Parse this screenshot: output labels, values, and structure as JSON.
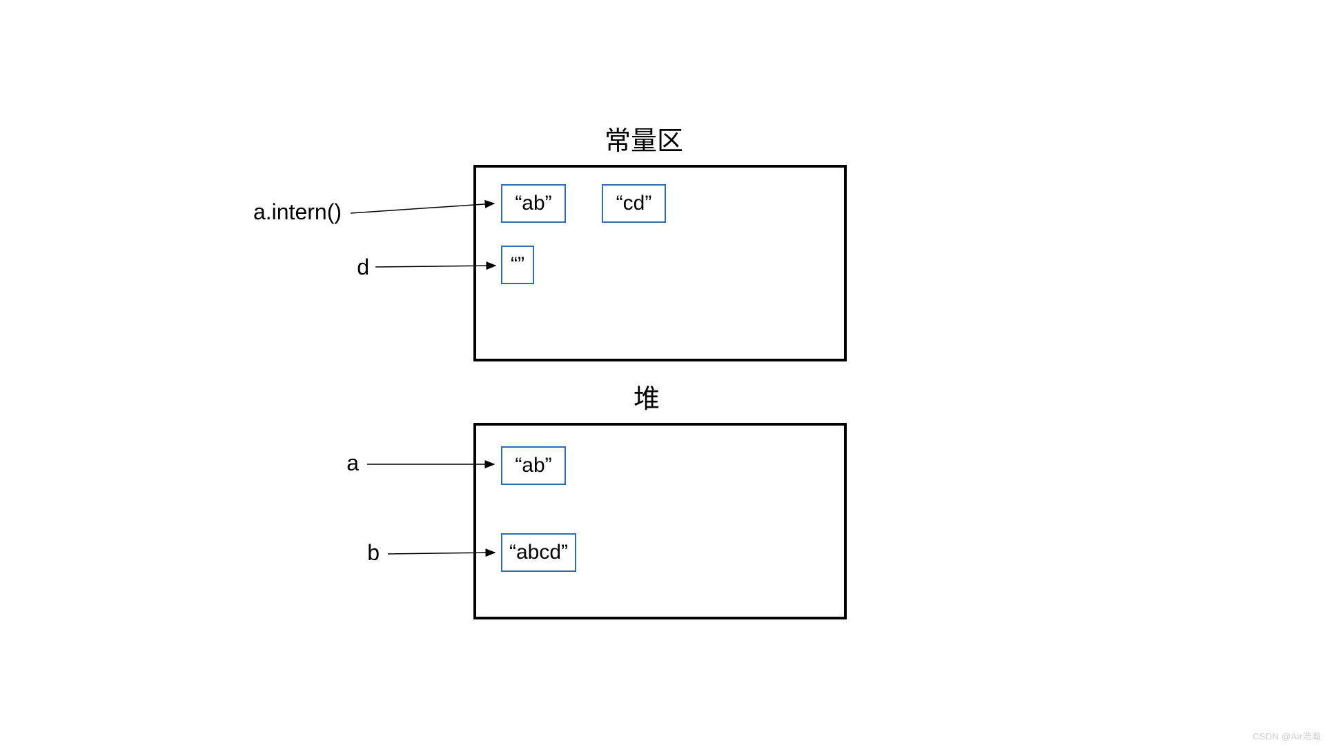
{
  "titles": {
    "constant_area": "常量区",
    "heap": "堆"
  },
  "constant_area": {
    "cell_ab": "“ab”",
    "cell_cd": "“cd”",
    "cell_empty": "“”"
  },
  "heap": {
    "cell_ab": "“ab”",
    "cell_abcd": "“abcd”"
  },
  "labels": {
    "a_intern": "a.intern()",
    "d": "d",
    "a": "a",
    "b": "b"
  },
  "watermark": "CSDN @Air浩瀚"
}
